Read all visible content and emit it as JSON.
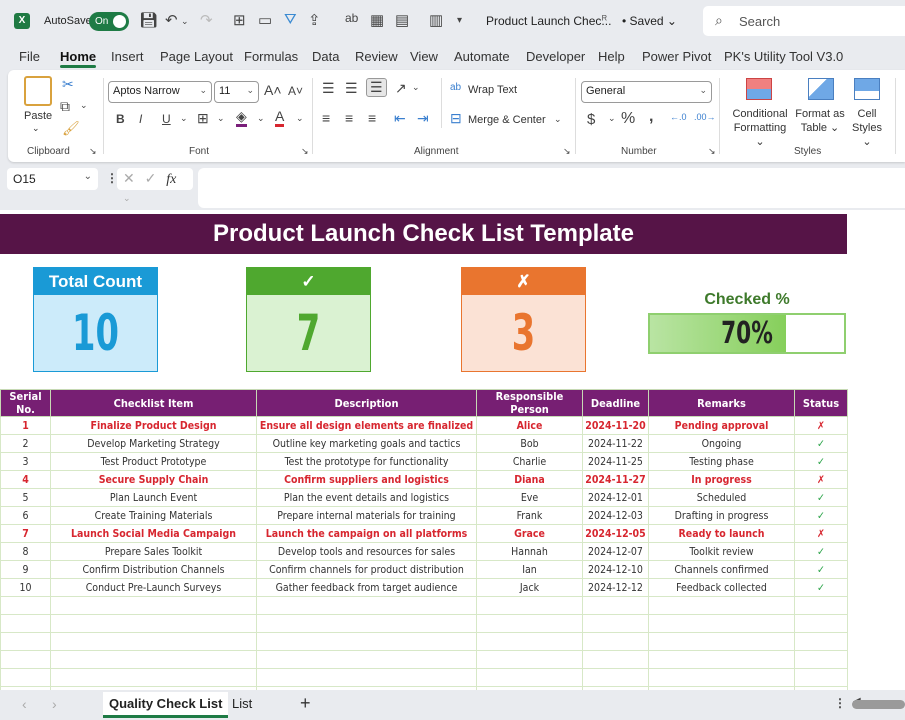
{
  "titlebar": {
    "app_logo": "X",
    "autosave_label": "AutoSave",
    "autosave_state": "On",
    "doc_title": "Product Launch Chec...",
    "saved_status": "• Saved",
    "search_placeholder": "Search"
  },
  "menu": [
    "File",
    "Home",
    "Insert",
    "Page Layout",
    "Formulas",
    "Data",
    "Review",
    "View",
    "Automate",
    "Developer",
    "Help",
    "Power Pivot",
    "PK's Utility Tool V3.0"
  ],
  "menu_active": "Home",
  "ribbon": {
    "clipboard": {
      "label": "Clipboard",
      "paste": "Paste"
    },
    "font": {
      "label": "Font",
      "font_name": "Aptos Narrow",
      "font_size": "11"
    },
    "alignment": {
      "label": "Alignment",
      "wrap_text": "Wrap Text",
      "merge_center": "Merge & Center"
    },
    "number": {
      "label": "Number",
      "format": "General"
    },
    "styles": {
      "label": "Styles",
      "conditional_1": "Conditional",
      "conditional_2": "Formatting",
      "format_table_1": "Format as",
      "format_table_2": "Table",
      "cell_styles_1": "Cell",
      "cell_styles_2": "Styles"
    }
  },
  "formula_bar": {
    "name_box": "O15",
    "formula": ""
  },
  "sheet": {
    "title": "Product Launch Check List Template",
    "cards": {
      "total": {
        "header": "Total Count",
        "value": "10",
        "color": "#1a9ad6"
      },
      "checked": {
        "header": "✓",
        "value": "7",
        "color": "#4fa82f"
      },
      "unchecked": {
        "header": "✗",
        "value": "3",
        "color": "#e9752f"
      }
    },
    "checked_pct": {
      "label": "Checked %",
      "value": 0.7,
      "text": "70%"
    },
    "table": {
      "headers": [
        "Serial No.",
        "Checklist Item",
        "Description",
        "Responsible Person",
        "Deadline",
        "Remarks",
        "Status"
      ],
      "rows": [
        [
          "1",
          "Finalize Product Design",
          "Ensure all design elements are finalized",
          "Alice",
          "2024-11-20",
          "Pending approval",
          "✗"
        ],
        [
          "2",
          "Develop Marketing Strategy",
          "Outline key marketing goals and tactics",
          "Bob",
          "2024-11-22",
          "Ongoing",
          "✓"
        ],
        [
          "3",
          "Test Product Prototype",
          "Test the prototype for functionality",
          "Charlie",
          "2024-11-25",
          "Testing phase",
          "✓"
        ],
        [
          "4",
          "Secure Supply Chain",
          "Confirm suppliers and logistics",
          "Diana",
          "2024-11-27",
          "In progress",
          "✗"
        ],
        [
          "5",
          "Plan Launch Event",
          "Plan the event details and logistics",
          "Eve",
          "2024-12-01",
          "Scheduled",
          "✓"
        ],
        [
          "6",
          "Create Training Materials",
          "Prepare internal materials for training",
          "Frank",
          "2024-12-03",
          "Drafting in progress",
          "✓"
        ],
        [
          "7",
          "Launch Social Media Campaign",
          "Launch the campaign on all platforms",
          "Grace",
          "2024-12-05",
          "Ready to launch",
          "✗"
        ],
        [
          "8",
          "Prepare Sales Toolkit",
          "Develop tools and resources for sales",
          "Hannah",
          "2024-12-07",
          "Toolkit review",
          "✓"
        ],
        [
          "9",
          "Confirm Distribution Channels",
          "Confirm channels for product distribution",
          "Ian",
          "2024-12-10",
          "Channels confirmed",
          "✓"
        ],
        [
          "10",
          "Conduct Pre-Launch Surveys",
          "Gather feedback from target audience",
          "Jack",
          "2024-12-12",
          "Feedback collected",
          "✓"
        ]
      ]
    }
  },
  "tabs": {
    "sheets": [
      "Quality Check List",
      "List"
    ],
    "active": "Quality Check List",
    "add": "+"
  }
}
